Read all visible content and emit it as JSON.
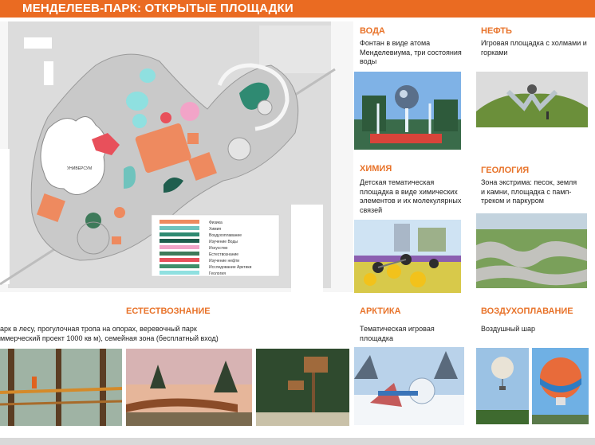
{
  "header": {
    "title": "МЕНДЕЛЕЕВ-ПАРК: ОТКРЫТЫЕ ПЛОЩАДКИ"
  },
  "plan": {
    "building_label": "УНИВЕРСУМ",
    "legend": [
      {
        "label": "Физика",
        "color": "#ee8a5f"
      },
      {
        "label": "Химия",
        "color": "#6fc3bd"
      },
      {
        "label": "Воздухоплавание",
        "color": "#2f8a72"
      },
      {
        "label": "Изучение Воды",
        "color": "#1f5e4e"
      },
      {
        "label": "Искусство",
        "color": "#f2a4c8"
      },
      {
        "label": "Естествознание",
        "color": "#3e7a5a"
      },
      {
        "label": "Изучение нефти",
        "color": "#e8505b"
      },
      {
        "label": "Исследование Арктики",
        "color": "#3f8f6b"
      },
      {
        "label": "Геология",
        "color": "#8fe0e0"
      }
    ]
  },
  "sections": {
    "water": {
      "title": "ВОДА",
      "text": [
        "Фонтан в виде атома",
        "Менделевиума, три состояния",
        "воды"
      ]
    },
    "oil": {
      "title": "НЕФТЬ",
      "text": [
        "Игровая площадка с холмами и",
        "горками"
      ]
    },
    "chemistry": {
      "title": "ХИМИЯ",
      "text": [
        "Детская тематическая",
        "площадка в виде химических",
        "элементов и их молекулярных",
        "связей"
      ]
    },
    "geology": {
      "title": "ГЕОЛОГИЯ",
      "text": [
        "Зона экстрима: песок, земля",
        "и камни, площадка с памп-",
        "треком и паркуром"
      ]
    },
    "natural_science": {
      "title": "ЕСТЕСТВОЗНАНИЕ",
      "text": [
        "арк в лесу, прогулочная тропа на опорах, веревочный парк",
        "ммерческий проект 1000 кв м), семейная зона (бесплатный вход)"
      ]
    },
    "arctic": {
      "title": "АРКТИКА",
      "text": [
        "Тематическая игровая",
        "площадка"
      ]
    },
    "aeronautics": {
      "title": "ВОЗДУХОПЛАВАНИЕ",
      "text": [
        "Воздушный шар"
      ]
    }
  },
  "colors": {
    "accent": "#ea6b22",
    "heading": "#e8732a"
  }
}
